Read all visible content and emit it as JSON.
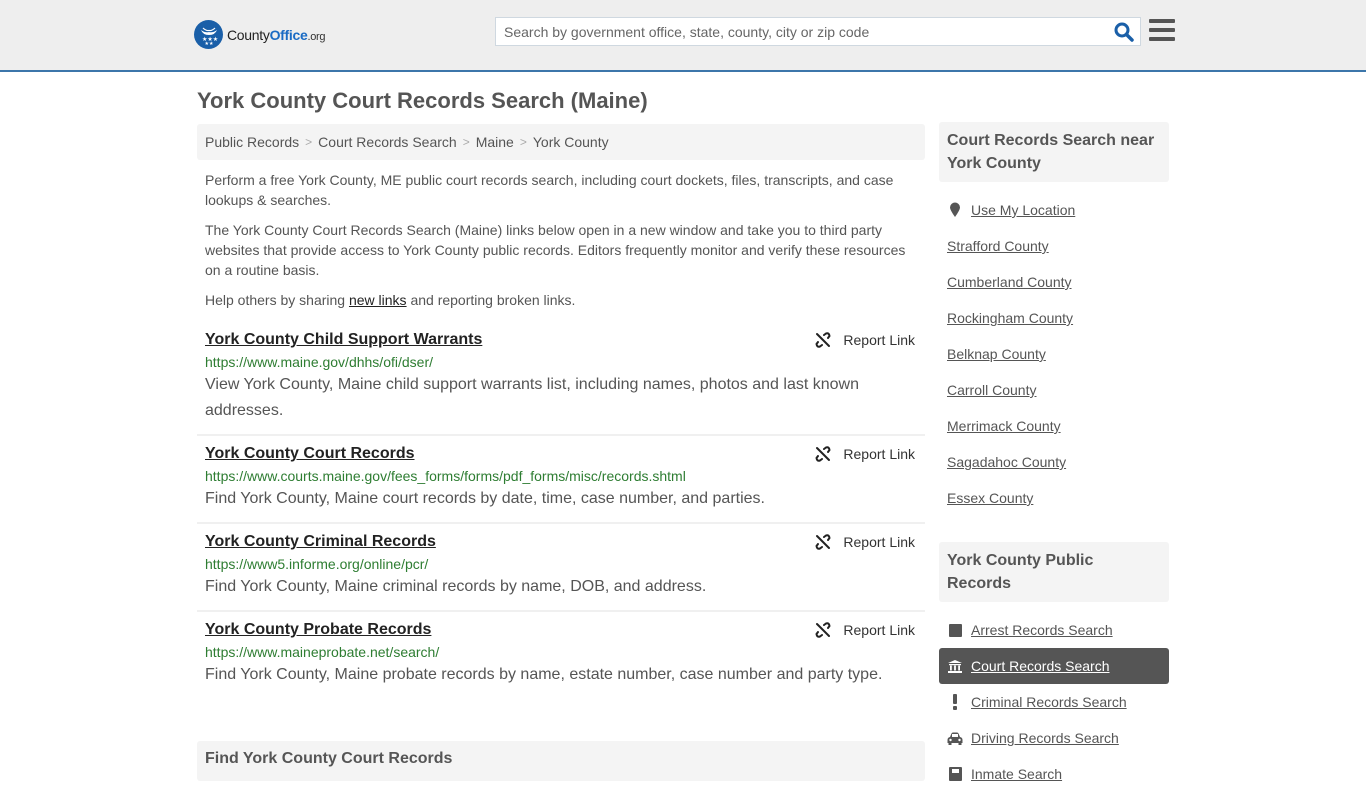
{
  "header": {
    "logo": {
      "name_prefix": "County",
      "name_bold": "Office",
      "name_suffix": ".org"
    },
    "search": {
      "placeholder": "Search by government office, state, county, city or zip code",
      "value": ""
    },
    "colors": {
      "brand_blue": "#1a5fa8",
      "header_border": "#3c76aa",
      "header_bg": "#eeeeee"
    }
  },
  "page": {
    "title": "York County Court Records Search (Maine)",
    "breadcrumb": [
      {
        "label": "Public Records"
      },
      {
        "label": "Court Records Search"
      },
      {
        "label": "Maine"
      },
      {
        "label": "York County"
      }
    ],
    "breadcrumb_separator": ">",
    "intro": {
      "p1": "Perform a free York County, ME public court records search, including court dockets, files, transcripts, and case lookups & searches.",
      "p2": "The York County Court Records Search (Maine) links below open in a new window and take you to third party websites that provide access to York County public records. Editors frequently monitor and verify these resources on a routine basis.",
      "p3_before": "Help others by sharing ",
      "p3_link": "new links",
      "p3_after": " and reporting broken links."
    },
    "report_label": "Report Link",
    "listings": [
      {
        "title": "York County Child Support Warrants",
        "url": "https://www.maine.gov/dhhs/ofi/dser/",
        "description": "View York County, Maine child support warrants list, including names, photos and last known addresses."
      },
      {
        "title": "York County Court Records",
        "url": "https://www.courts.maine.gov/fees_forms/forms/pdf_forms/misc/records.shtml",
        "description": "Find York County, Maine court records by date, time, case number, and parties."
      },
      {
        "title": "York County Criminal Records",
        "url": "https://www5.informe.org/online/pcr/",
        "description": "Find York County, Maine criminal records by name, DOB, and address."
      },
      {
        "title": "York County Probate Records",
        "url": "https://www.maineprobate.net/search/",
        "description": "Find York County, Maine probate records by name, estate number, case number and party type."
      }
    ],
    "find_heading": "Find York County Court Records"
  },
  "sidebar": {
    "nearby_heading": "Court Records Search near York County",
    "use_location": "Use My Location",
    "nearby": [
      "Strafford County",
      "Cumberland County",
      "Rockingham County",
      "Belknap County",
      "Carroll County",
      "Merrimack County",
      "Sagadahoc County",
      "Essex County"
    ],
    "public_heading": "York County Public Records",
    "public_records": [
      {
        "label": "Arrest Records Search",
        "icon": "square-icon",
        "active": false
      },
      {
        "label": "Court Records Search",
        "icon": "courthouse-icon",
        "active": true
      },
      {
        "label": "Criminal Records Search",
        "icon": "exclamation-icon",
        "active": false
      },
      {
        "label": "Driving Records Search",
        "icon": "car-icon",
        "active": false
      },
      {
        "label": "Inmate Search",
        "icon": "inmate-icon",
        "active": false
      }
    ]
  }
}
